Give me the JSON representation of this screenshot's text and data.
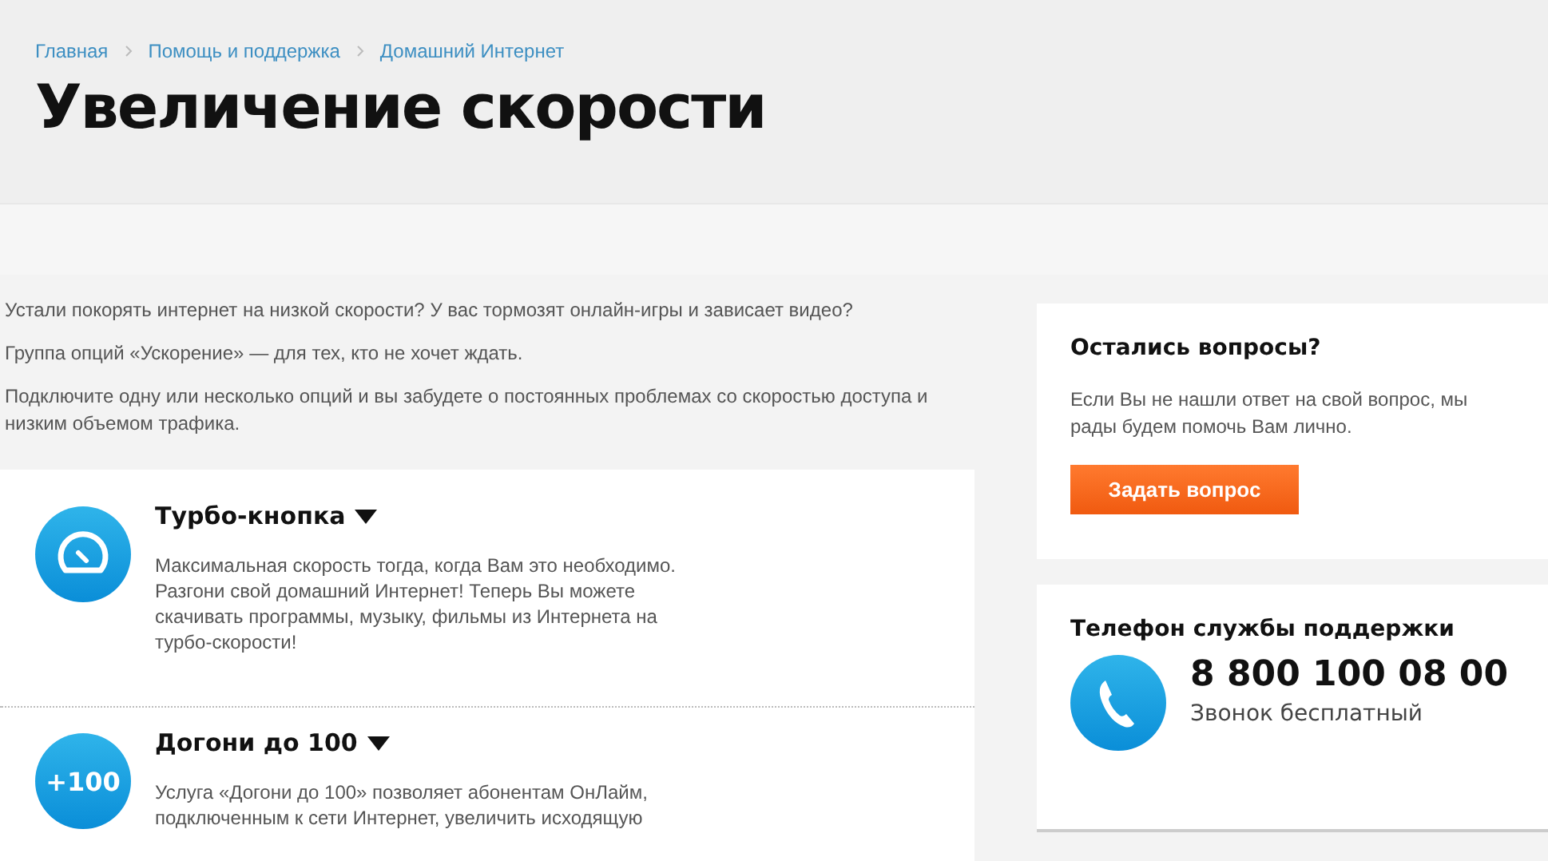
{
  "breadcrumbs": [
    "Главная",
    "Помощь и поддержка",
    "Домашний Интернет"
  ],
  "title": "Увеличение скорости",
  "intro": [
    "Устали покорять интернет на низкой скорости? У вас тормозят онлайн-игры и зависает видео?",
    "Группа опций «Ускорение» — для тех, кто не хочет ждать.",
    "Подключите одну или несколько опций и вы забудете о постоянных проблемах со скоростью доступа и низким объемом трафика."
  ],
  "options": [
    {
      "kind": "gauge",
      "title": "Турбо-кнопка",
      "text": "Максимальная скорость тогда, когда Вам это необходимо. Разгони свой домашний Интернет! Теперь Вы можете скачивать программы, музыку, фильмы из Интернета на турбо-скорости!"
    },
    {
      "kind": "badge",
      "badge": "+100",
      "title": "Догони до 100",
      "text": "Услуга «Догони до 100» позволяет абонентам ОнЛайм, подключенным к сети Интернет, увеличить исходящую"
    }
  ],
  "questions": {
    "title": "Остались вопросы?",
    "text": "Если Вы не нашли ответ на свой вопрос, мы рады будем помочь Вам лично.",
    "button": "Задать вопрос"
  },
  "support": {
    "title": "Телефон службы поддержки",
    "phone": "8 800 100 08 00",
    "note": "Звонок бесплатный"
  }
}
